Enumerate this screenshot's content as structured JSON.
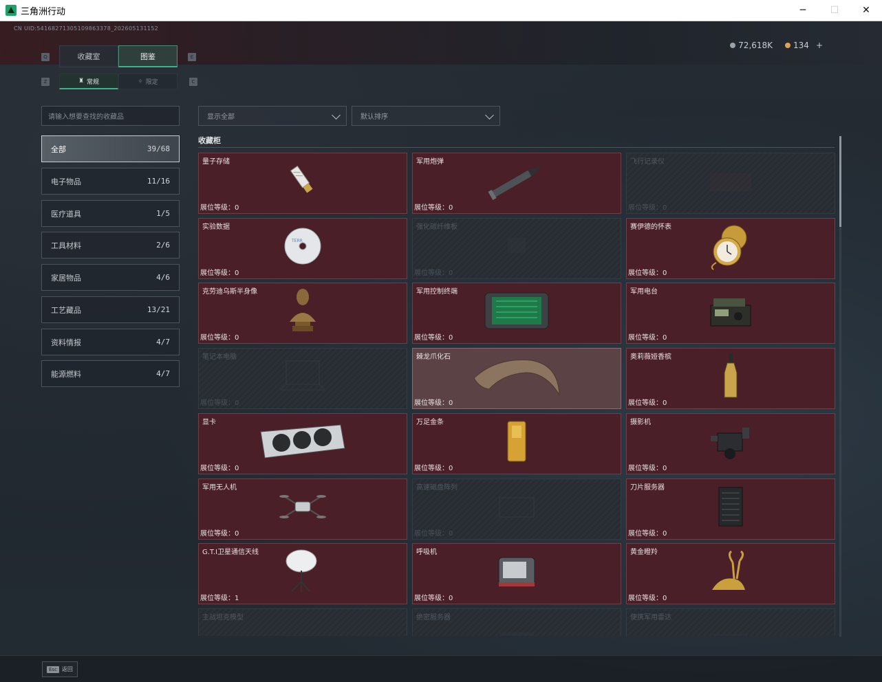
{
  "window": {
    "title": "三角洲行动",
    "minimize": "─",
    "maximize": "☐",
    "close": "✕"
  },
  "uid": "CN UID:5416827130510986337​8_202605131152",
  "currency": [
    {
      "icon": "silver-coin-icon",
      "value": "72,618K"
    },
    {
      "icon": "gold-coin-icon",
      "value": "134"
    }
  ],
  "currency_add": "+",
  "tabs": [
    {
      "label": "收藏室"
    },
    {
      "label": "图鉴"
    }
  ],
  "subtabs": [
    {
      "label": "常规"
    },
    {
      "label": "限定"
    }
  ],
  "keys": {
    "q": "Q",
    "e": "E",
    "z": "Z",
    "c": "C"
  },
  "search": {
    "placeholder": "请输入想要查找的收藏品"
  },
  "filters": {
    "show": "显示全部",
    "sort": "默认排序"
  },
  "categories": [
    {
      "label": "全部",
      "count": "39/68"
    },
    {
      "label": "电子物品",
      "count": "11/16"
    },
    {
      "label": "医疗道具",
      "count": "1/5"
    },
    {
      "label": "工具材料",
      "count": "2/6"
    },
    {
      "label": "家居物品",
      "count": "4/6"
    },
    {
      "label": "工艺藏品",
      "count": "13/21"
    },
    {
      "label": "资料情报",
      "count": "4/7"
    },
    {
      "label": "能源燃料",
      "count": "4/7"
    }
  ],
  "cabinet": {
    "title": "收藏柜",
    "level_prefix": "展位等级：",
    "items": [
      {
        "name": "量子存储",
        "level": "0",
        "state": "owned",
        "icon": "usb-drive-icon"
      },
      {
        "name": "军用炮弹",
        "level": "0",
        "state": "owned",
        "icon": "shell-icon"
      },
      {
        "name": "飞行记录仪",
        "level": "0",
        "state": "empty",
        "icon": "flight-recorder-icon"
      },
      {
        "name": "实验数据",
        "level": "0",
        "state": "owned",
        "icon": "disc-icon"
      },
      {
        "name": "强化碳纤维板",
        "level": "0",
        "state": "empty",
        "icon": "carbon-plate-icon"
      },
      {
        "name": "赛伊德的怀表",
        "level": "0",
        "state": "owned",
        "icon": "pocket-watch-icon"
      },
      {
        "name": "克劳迪乌斯半身像",
        "level": "0",
        "state": "owned",
        "icon": "bust-icon"
      },
      {
        "name": "军用控制终端",
        "level": "0",
        "state": "owned",
        "icon": "terminal-icon"
      },
      {
        "name": "军用电台",
        "level": "0",
        "state": "owned",
        "icon": "radio-icon"
      },
      {
        "name": "笔记本电脑",
        "level": "0",
        "state": "empty",
        "icon": "laptop-icon"
      },
      {
        "name": "棘龙爪化石",
        "level": "0",
        "state": "highlight",
        "icon": "claw-fossil-icon"
      },
      {
        "name": "奥莉薇娅香槟",
        "level": "0",
        "state": "owned",
        "icon": "champagne-icon"
      },
      {
        "name": "显卡",
        "level": "0",
        "state": "owned",
        "icon": "gpu-icon"
      },
      {
        "name": "万足金条",
        "level": "0",
        "state": "owned",
        "icon": "gold-bar-icon"
      },
      {
        "name": "摄影机",
        "level": "0",
        "state": "owned",
        "icon": "camera-icon"
      },
      {
        "name": "军用无人机",
        "level": "0",
        "state": "owned",
        "icon": "drone-icon"
      },
      {
        "name": "高速磁盘阵列",
        "level": "0",
        "state": "empty",
        "icon": "disk-array-icon"
      },
      {
        "name": "刀片服务器",
        "level": "0",
        "state": "owned",
        "icon": "server-icon"
      },
      {
        "name": "G.T.I卫星通信天线",
        "level": "1",
        "state": "owned",
        "icon": "satellite-dish-icon"
      },
      {
        "name": "呼吸机",
        "level": "0",
        "state": "owned",
        "icon": "ventilator-icon"
      },
      {
        "name": "黄金瞪羚",
        "level": "0",
        "state": "owned",
        "icon": "gold-gazelle-icon"
      },
      {
        "name": "主战坦克模型",
        "level": "",
        "state": "empty",
        "icon": "tank-model-icon"
      },
      {
        "name": "绝密服务器",
        "level": "",
        "state": "empty",
        "icon": "secret-server-icon"
      },
      {
        "name": "便携军用雷达",
        "level": "",
        "state": "empty",
        "icon": "radar-icon"
      }
    ]
  },
  "footer": {
    "key": "Esc",
    "label": "返回"
  }
}
